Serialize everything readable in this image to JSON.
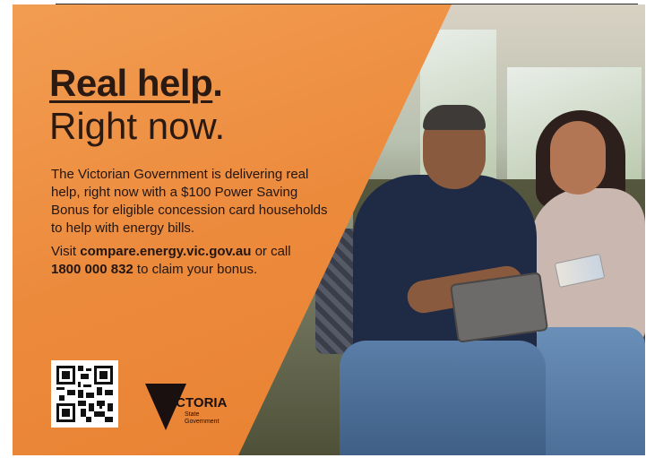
{
  "headline": {
    "line1_underlined": "Real help",
    "line1_end": ".",
    "line2": "Right now."
  },
  "body": {
    "paragraph1": "The Victorian Government is delivering real help, right now with a $100 Power Saving Bonus for eligible concession card households to help with energy bills.",
    "p2_visit": "Visit ",
    "p2_url": "compare.energy.vic.gov.au",
    "p2_or_call": " or call",
    "p2_phone": "1800 000 832",
    "p2_end": " to claim your bonus."
  },
  "logo": {
    "word": "VICTORIA",
    "sub_line1": "State",
    "sub_line2": "Government"
  },
  "colors": {
    "panel_orange": "#ec8a3c",
    "text_dark": "#231510"
  },
  "icons": [
    "qr-code-icon",
    "victoria-triangle-icon"
  ]
}
